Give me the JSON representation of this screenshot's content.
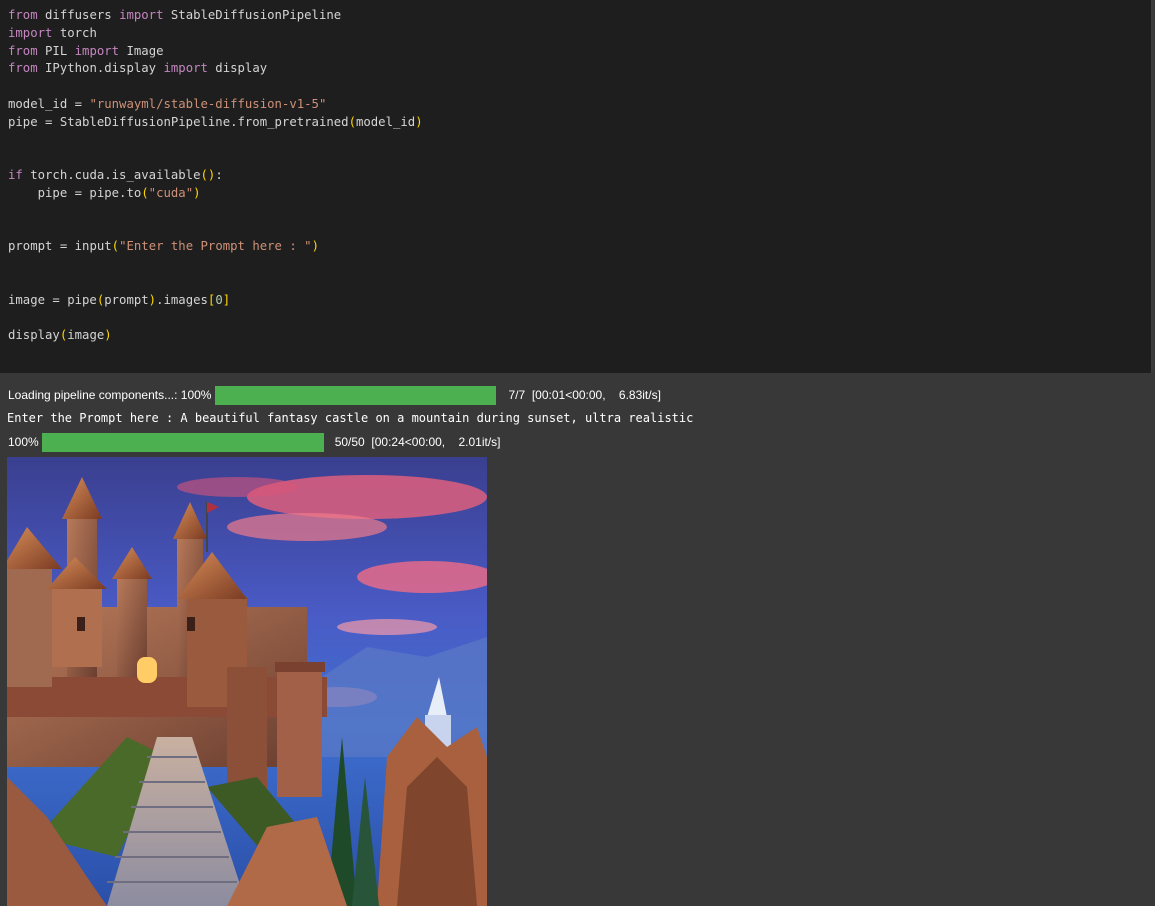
{
  "code_cell": {
    "lines": [
      [
        {
          "t": "from",
          "c": "kw"
        },
        {
          "t": " diffusers ",
          "c": "plain"
        },
        {
          "t": "import",
          "c": "kw"
        },
        {
          "t": " StableDiffusionPipeline",
          "c": "plain"
        }
      ],
      [
        {
          "t": "import",
          "c": "kw"
        },
        {
          "t": " torch",
          "c": "plain"
        }
      ],
      [
        {
          "t": "from",
          "c": "kw"
        },
        {
          "t": " PIL ",
          "c": "plain"
        },
        {
          "t": "import",
          "c": "kw"
        },
        {
          "t": " Image",
          "c": "plain"
        }
      ],
      [
        {
          "t": "from",
          "c": "kw"
        },
        {
          "t": " IPython.display ",
          "c": "plain"
        },
        {
          "t": "import",
          "c": "kw"
        },
        {
          "t": " display",
          "c": "plain"
        }
      ],
      [],
      [
        {
          "t": "model_id = ",
          "c": "plain"
        },
        {
          "t": "\"runwayml/stable-diffusion-v1-5\"",
          "c": "str"
        }
      ],
      [
        {
          "t": "pipe = StableDiffusionPipeline.from_pretrained",
          "c": "plain"
        },
        {
          "t": "(",
          "c": "paren"
        },
        {
          "t": "model_id",
          "c": "plain"
        },
        {
          "t": ")",
          "c": "paren"
        }
      ],
      [],
      [],
      [
        {
          "t": "if",
          "c": "kw"
        },
        {
          "t": " torch.cuda.is_available",
          "c": "plain"
        },
        {
          "t": "()",
          "c": "paren"
        },
        {
          "t": ":",
          "c": "plain"
        }
      ],
      [
        {
          "t": "    pipe = pipe.to",
          "c": "plain"
        },
        {
          "t": "(",
          "c": "paren"
        },
        {
          "t": "\"cuda\"",
          "c": "str"
        },
        {
          "t": ")",
          "c": "paren"
        }
      ],
      [],
      [],
      [
        {
          "t": "prompt = ",
          "c": "plain"
        },
        {
          "t": "input",
          "c": "plain"
        },
        {
          "t": "(",
          "c": "paren"
        },
        {
          "t": "\"Enter the Prompt here : \"",
          "c": "str"
        },
        {
          "t": ")",
          "c": "paren"
        }
      ],
      [],
      [],
      [
        {
          "t": "image = pipe",
          "c": "plain"
        },
        {
          "t": "(",
          "c": "paren"
        },
        {
          "t": "prompt",
          "c": "plain"
        },
        {
          "t": ")",
          "c": "paren"
        },
        {
          "t": ".images",
          "c": "plain"
        },
        {
          "t": "[",
          "c": "paren"
        },
        {
          "t": "0",
          "c": "num"
        },
        {
          "t": "]",
          "c": "paren"
        }
      ],
      [],
      [
        {
          "t": "display",
          "c": "plain"
        },
        {
          "t": "(",
          "c": "paren"
        },
        {
          "t": "image",
          "c": "plain"
        },
        {
          "t": ")",
          "c": "paren"
        }
      ]
    ]
  },
  "output": {
    "progress1": {
      "label": "Loading  pipeline  components...:  100%",
      "fraction": 1.0,
      "stats": "7/7  [00:01<00:00,    6.83it/s]"
    },
    "stdout_prompt": "Enter the Prompt here : A beautiful fantasy castle on a mountain during sunset, ultra realistic",
    "progress2": {
      "label": "100%",
      "fraction": 1.0,
      "stats": "50/50  [00:24<00:00,    2.01it/s]"
    },
    "image_alt": "Generated image: fantasy castle on a mountain at sunset"
  },
  "colors": {
    "progress_fill": "#4caf50",
    "code_bg": "#1e1e1e",
    "output_bg": "#383838"
  }
}
